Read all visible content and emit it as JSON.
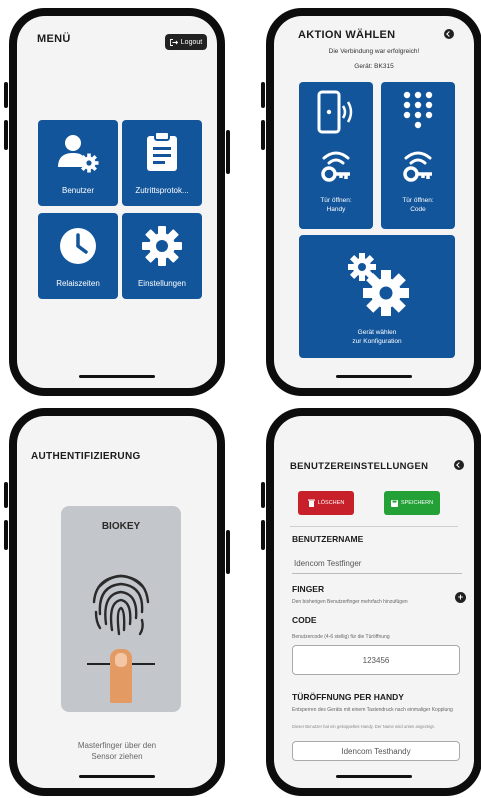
{
  "menu": {
    "title": "MENÜ",
    "logout_label": "Logout",
    "tiles": [
      {
        "label": "Benutzer",
        "icon": "user-gear-icon"
      },
      {
        "label": "Zutrittsprotok...",
        "icon": "clipboard-icon"
      },
      {
        "label": "Relaiszeiten",
        "icon": "clock-icon"
      },
      {
        "label": "Einstellungen",
        "icon": "gear-icon"
      }
    ]
  },
  "action": {
    "title": "AKTION WÄHLEN",
    "connection_status": "Die Verbindung war erfolgreich!",
    "device": "Gerät: BK315",
    "tiles": [
      {
        "label_line1": "Tür öffnen:",
        "label_line2": "Handy",
        "icon": "phone-wireless-key-icon"
      },
      {
        "label_line1": "Tür öffnen:",
        "label_line2": "Code",
        "icon": "keypad-wireless-key-icon"
      },
      {
        "label_line1": "Gerät wählen",
        "label_line2": "zur Konfiguration",
        "icon": "gears-icon"
      }
    ]
  },
  "auth": {
    "title": "AUTHENTIFIZIERUNG",
    "card_title": "BIOKEY",
    "hint_line1": "Masterfinger über den",
    "hint_line2": "Sensor ziehen"
  },
  "user_settings": {
    "title": "BENUTZEREINSTELLUNGEN",
    "delete_label": "LÖSCHEN",
    "save_label": "SPEICHERN",
    "username_title": "BENUTZERNAME",
    "username_value": "Idencom Testfinger",
    "finger_title": "FINGER",
    "finger_note": "Den bisherigen Benutzerfinger mehrfach hinzufügen",
    "code_title": "CODE",
    "code_note": "Benutzercode (4-6 stellig) für die Türöffnung",
    "code_value": "123456",
    "handy_title": "TÜRÖFFNUNG PER HANDY",
    "handy_note": "Entsperren des Geräts mit einem Tastendruck nach einmaliger Kopplung",
    "handy_note_small": "Dieser Benutzer hat ein gekoppeltes Handy. Der Name wird unten angezeigt.",
    "handy_value": "Idencom Testhandy"
  },
  "colors": {
    "tile_blue": "#12559b",
    "delete_red": "#c8202b",
    "save_green": "#23a136",
    "biokey_gray": "#c3c6ca",
    "finger_orange": "#e39a63"
  }
}
